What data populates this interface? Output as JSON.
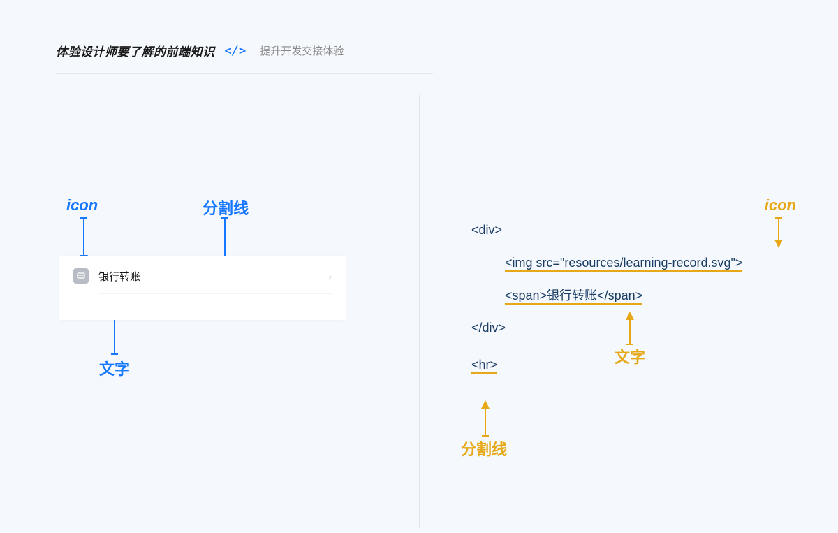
{
  "header": {
    "title": "体验设计师要了解的前端知识",
    "code_icon": "</>",
    "subtitle": "提升开发交接体验"
  },
  "left": {
    "label_icon": "icon",
    "label_divider": "分割线",
    "label_text": "文字",
    "list_item_text": "银行转账"
  },
  "right": {
    "label_icon": "icon",
    "label_text": "文字",
    "label_divider": "分割线",
    "code": {
      "div_open": "<div>",
      "img_line": "<img src=\"resources/learning-record.svg\">",
      "span_line": "<span>银行转账</span>",
      "div_close": "</div>",
      "hr_line": "<hr>"
    }
  }
}
